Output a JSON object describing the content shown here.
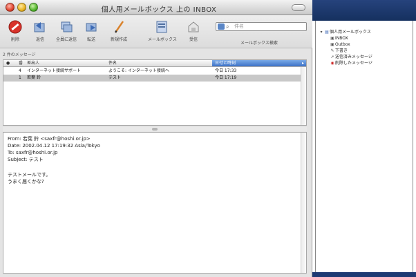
{
  "window": {
    "title": "個人用メールボックス 上の INBOX"
  },
  "toolbar": {
    "buttons": [
      {
        "label": "削除",
        "icon": "delete-icon"
      },
      {
        "label": "返信",
        "icon": "reply-icon"
      },
      {
        "label": "全員に返信",
        "icon": "reply-all-icon"
      },
      {
        "label": "転送",
        "icon": "forward-icon"
      },
      {
        "label": "新規作成",
        "icon": "compose-icon"
      },
      {
        "label": "メールボックス",
        "icon": "mailbox-icon"
      },
      {
        "label": "受信",
        "icon": "get-mail-icon"
      }
    ],
    "search": {
      "placeholder": "件名",
      "caption": "メールボックス検索"
    }
  },
  "status": {
    "text": "2 件のメッセージ"
  },
  "message_list": {
    "columns": [
      "●",
      "番",
      "差出人",
      "件名",
      "日付と時刻"
    ],
    "rows": [
      {
        "num": "4",
        "from": "インターネット接続サポート",
        "subject": "ようこそ: インターネット接続へ",
        "date": "今日 17:33"
      },
      {
        "num": "1",
        "from": "若葉 鈴",
        "subject": "テスト",
        "date": "今日 17:19"
      }
    ]
  },
  "preview": {
    "from": "From: 若葉 鈴 <saxfr@hoshi.or.jp>",
    "date": "Date: 2002.04.12 17:19:32 Asia/Tokyo",
    "to": "To: saxfr@hoshi.or.jp",
    "subject": "Subject: テスト",
    "body_line1": "テストメールです。",
    "body_line2": "うまく届くかな?"
  },
  "mailboxes": {
    "root": "個人用メールボックス",
    "items": [
      "INBOX",
      "Outbox",
      "下書き",
      "送信済みメッセージ",
      "削除したメッセージ"
    ]
  },
  "colors": {
    "selected_column": "#3d72c7",
    "selected_row": "#c8c8c8",
    "drawer_frame": "#15305f"
  }
}
